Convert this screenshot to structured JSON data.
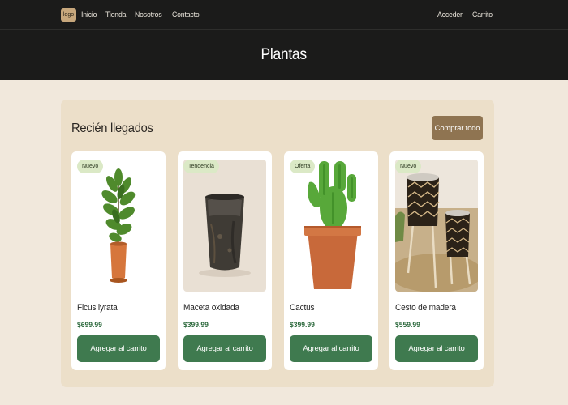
{
  "nav": {
    "logo_label": "logo",
    "links": [
      "Inicio",
      "Tienda",
      "Nosotros",
      "Contacto"
    ],
    "account": {
      "login": "Acceder",
      "cart": "Carrito"
    }
  },
  "hero": {
    "title": "Plantas"
  },
  "section": {
    "title": "Recién llegados",
    "shop_all_label": "Comprar todo"
  },
  "products": [
    {
      "name": "Ficus lyrata",
      "price": "$699.99",
      "badge": "Nuevo",
      "image_icon": "fiddle-leaf-fig-plant",
      "button_label": "Agregar al carrito"
    },
    {
      "name": "Maceta oxidada",
      "price": "$399.99",
      "badge": "Tendencia",
      "image_icon": "rusted-vase",
      "button_label": "Agregar al carrito"
    },
    {
      "name": "Cactus",
      "price": "$399.99",
      "badge": "Oferta",
      "image_icon": "cactus-in-terracotta-pot",
      "button_label": "Agregar al carrito"
    },
    {
      "name": "Cesto de madera",
      "price": "$559.99",
      "badge": "Nuevo",
      "image_icon": "woven-planter-baskets",
      "button_label": "Agregar al carrito"
    }
  ],
  "colors": {
    "header_bg": "#1b1b1a",
    "page_bg": "#f1e8dc",
    "panel_bg": "#ecdfc9",
    "accent_brown": "#8f7451",
    "accent_green": "#3f7a4f",
    "price_green": "#2f6b3f",
    "badge_bg": "#dbe9c6"
  }
}
